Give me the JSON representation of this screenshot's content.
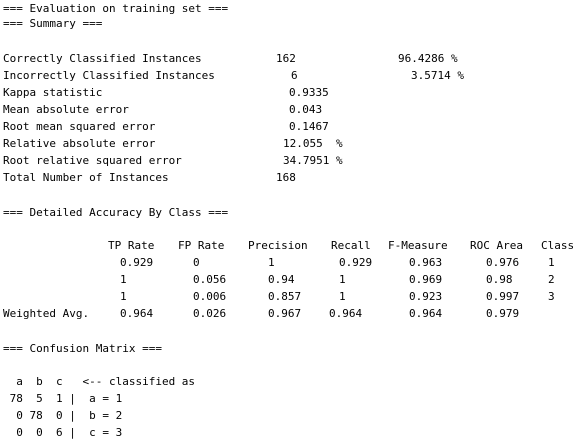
{
  "header": {
    "line1": "=== Evaluation on training set ===",
    "line2": "=== Summary ==="
  },
  "summary": [
    {
      "label": "Correctly Classified Instances",
      "value": "162",
      "pct": "96.4286 %"
    },
    {
      "label": "Incorrectly Classified Instances",
      "value": "6",
      "pct": "3.5714 %"
    },
    {
      "label": "Kappa statistic",
      "value": "0.9335",
      "pct": ""
    },
    {
      "label": "Mean absolute error",
      "value": "0.043",
      "pct": ""
    },
    {
      "label": "Root mean squared error",
      "value": "0.1467",
      "pct": ""
    },
    {
      "label": "Relative absolute error",
      "value": "12.055  %",
      "pct": ""
    },
    {
      "label": "Root relative squared error",
      "value": "34.7951 %",
      "pct": ""
    },
    {
      "label": "Total Number of Instances",
      "value": "168",
      "pct": ""
    }
  ],
  "accuracy": {
    "title": "=== Detailed Accuracy By Class ===",
    "headers": [
      "TP Rate",
      "FP Rate",
      "Precision",
      "Recall",
      "F-Measure",
      "ROC Area",
      "Class"
    ],
    "rows": [
      {
        "label": "",
        "cells": [
          "0.929",
          "0",
          "1",
          "0.929",
          "0.963",
          "0.976",
          "1"
        ]
      },
      {
        "label": "",
        "cells": [
          "1",
          "0.056",
          "0.94",
          "1",
          "0.969",
          "0.98",
          "2"
        ]
      },
      {
        "label": "",
        "cells": [
          "1",
          "0.006",
          "0.857",
          "1",
          "0.923",
          "0.997",
          "3"
        ]
      },
      {
        "label": "Weighted Avg.",
        "cells": [
          "0.964",
          "0.026",
          "0.967",
          "0.964",
          "0.964",
          "0.979",
          ""
        ]
      }
    ]
  },
  "confusion": {
    "title": "=== Confusion Matrix ===",
    "lines": [
      "  a  b  c   <-- classified as",
      " 78  5  1 |  a = 1",
      "  0 78  0 |  b = 2",
      "  0  0  6 |  c = 3"
    ]
  }
}
